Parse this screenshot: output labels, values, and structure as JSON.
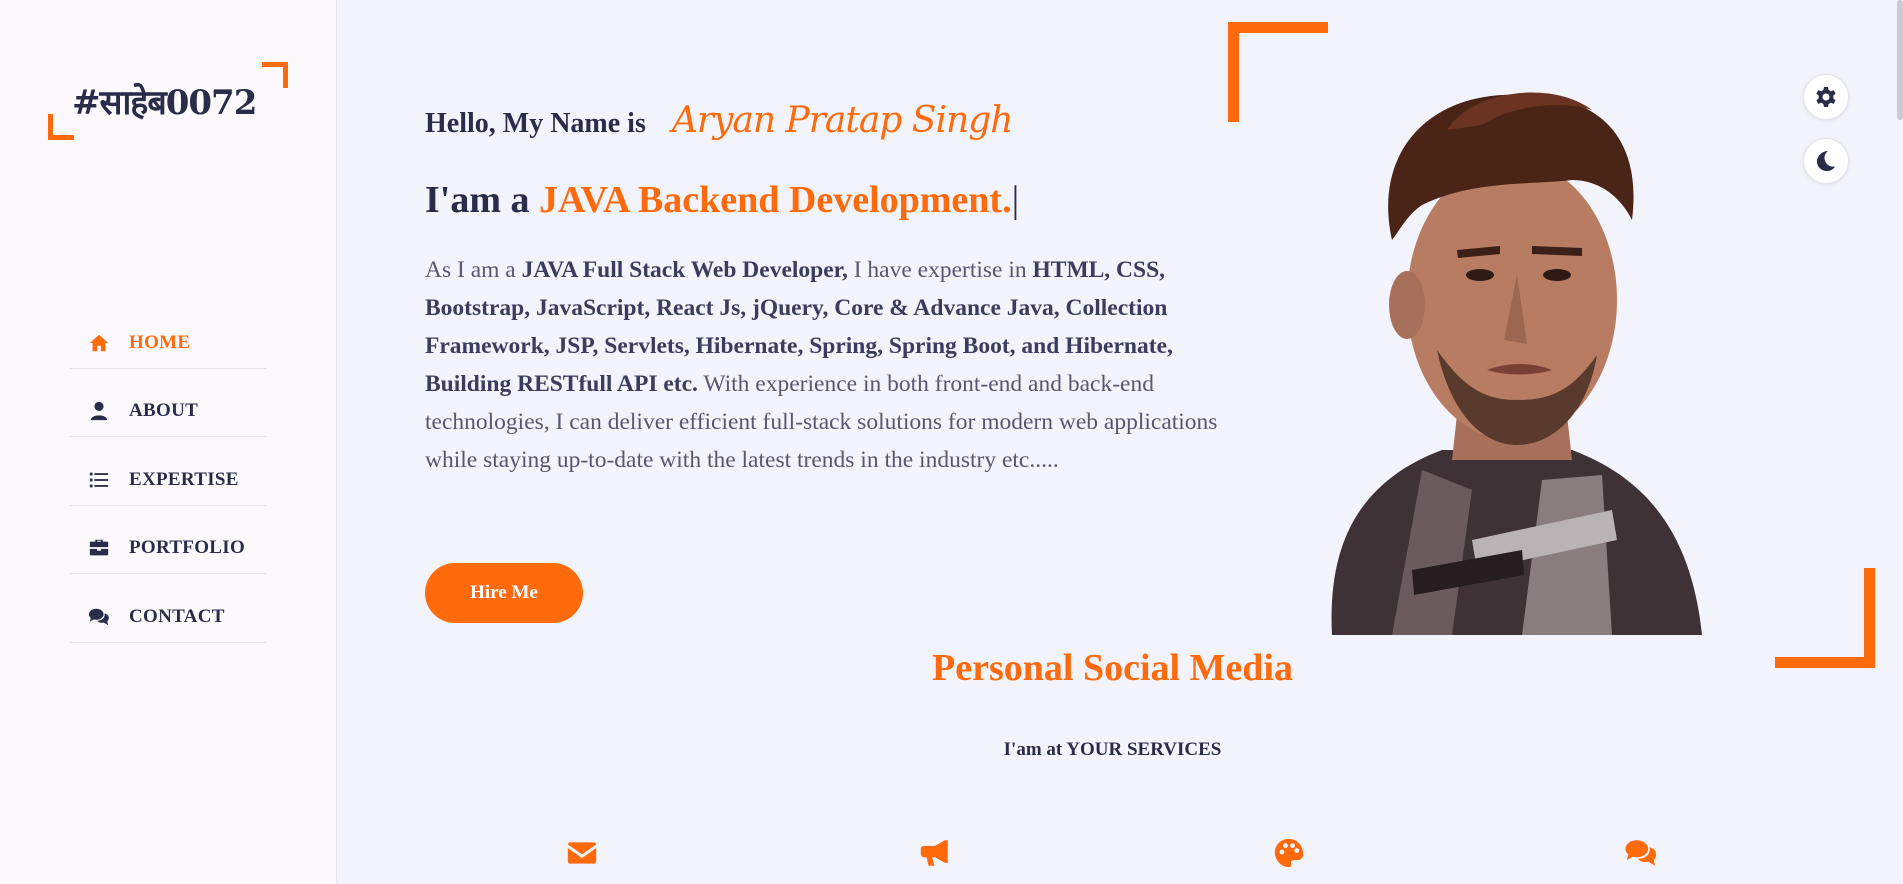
{
  "brand": {
    "logo_text": "#साहेब0072",
    "accent_color": "#ff6a0d",
    "text_color": "#2a2d4a"
  },
  "nav": {
    "items": [
      {
        "label": "HOME",
        "icon": "home-icon",
        "active": true
      },
      {
        "label": "ABOUT",
        "icon": "user-icon",
        "active": false
      },
      {
        "label": "EXPERTISE",
        "icon": "list-icon",
        "active": false
      },
      {
        "label": "PORTFOLIO",
        "icon": "briefcase-icon",
        "active": false
      },
      {
        "label": "CONTACT",
        "icon": "comments-icon",
        "active": false
      }
    ]
  },
  "hero": {
    "greeting": "Hello, My Name is",
    "name": "Aryan Pratap Singh",
    "role_prefix": "I'am a",
    "role_highlight": "JAVA Backend Development.",
    "role_cursor": "|",
    "bio": {
      "p1": "As I am a ",
      "b1": "JAVA Full Stack Web Developer,",
      "p2": " I have expertise in ",
      "b2": "HTML, CSS, Bootstrap, JavaScript, React Js, jQuery, Core & Advance Java, Collection Framework, JSP, Servlets, Hibernate, Spring, Spring Boot, and Hibernate, Building RESTfull API etc.",
      "p3": " With experience in both front-end and back-end technologies, I can deliver efficient full-stack solutions for modern web applications while staying up-to-date with the latest trends in the industry etc....."
    },
    "hire_button": "Hire Me"
  },
  "floating": {
    "settings_icon": "gear-icon",
    "theme_icon": "moon-icon"
  },
  "social": {
    "title": "Personal Social Media",
    "subtitle": "I'am at YOUR SERVICES",
    "icons": [
      "envelope-icon",
      "bullhorn-icon",
      "palette-icon",
      "comments-icon"
    ]
  }
}
